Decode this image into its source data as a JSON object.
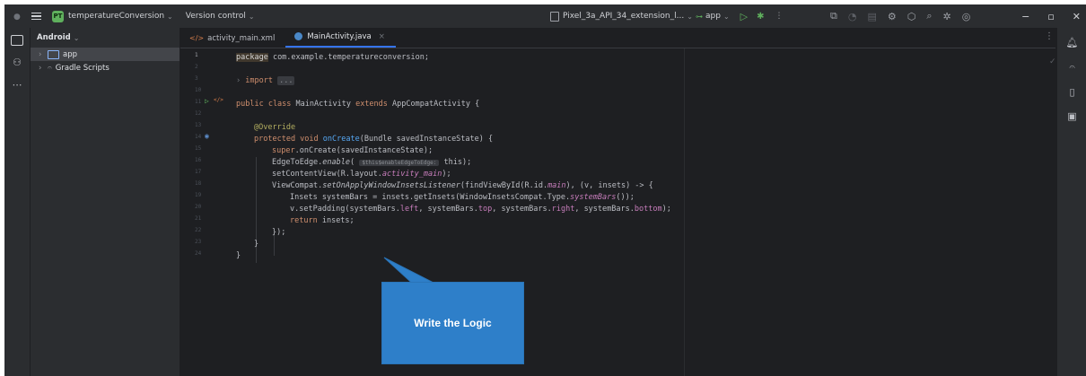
{
  "titlebar": {
    "project_badge": "PT",
    "project_name": "temperatureConversion",
    "version_control": "Version control",
    "device": "Pixel_3a_API_34_extension_l...",
    "app_config": "app"
  },
  "project_panel": {
    "view_mode": "Android",
    "tree": [
      {
        "label": "app",
        "selected": true
      },
      {
        "label": "Gradle Scripts",
        "selected": false
      }
    ]
  },
  "tabs": [
    {
      "label": "activity_main.xml",
      "active": false
    },
    {
      "label": "MainActivity.java",
      "active": true
    }
  ],
  "code": {
    "line_numbers": [
      "1",
      "2",
      "3",
      "10",
      "11",
      "12",
      "13",
      "14",
      "15",
      "16",
      "17",
      "18",
      "19",
      "20",
      "21",
      "22",
      "23",
      "24"
    ],
    "l1_kw": "package",
    "l1_rest": " com.example.temperatureconversion;",
    "l3_kw": "import",
    "l3_fold": "...",
    "l11_kw": "public class",
    "l11_name": " MainActivity ",
    "l11_kw2": "extends",
    "l11_rest": " AppCompatActivity {",
    "l13_ann": "@Override",
    "l14_kw": "protected void",
    "l14_fn": " onCreate",
    "l14_rest": "(Bundle savedInstanceState) {",
    "l15_kw": "super",
    "l15_rest": ".onCreate(savedInstanceState);",
    "l16_a": "EdgeToEdge.",
    "l16_it": "enable",
    "l16_b": "( ",
    "l16_hint": "$this$enableEdgeToEdge:",
    "l16_c": " this);",
    "l17_a": "setContentView(R.layout.",
    "l17_fld": "activity_main",
    "l17_b": ");",
    "l18_a": "ViewCompat.",
    "l18_it": "setOnApplyWindowInsetsListener",
    "l18_b": "(findViewById(R.id.",
    "l18_fld": "main",
    "l18_c": "), (v, insets) -> {",
    "l19_a": "Insets systemBars = insets.getInsets(WindowInsetsCompat.Type.",
    "l19_it": "systemBars",
    "l19_b": "());",
    "l20_a": "v.setPadding(systemBars.",
    "l20_f1": "left",
    "l20_b": ", systemBars.",
    "l20_f2": "top",
    "l20_c": ", systemBars.",
    "l20_f3": "right",
    "l20_d": ", systemBars.",
    "l20_f4": "bottom",
    "l20_e": ");",
    "l21_kw": "return",
    "l21_rest": " insets;",
    "l22": "});",
    "l23": "}",
    "l24": "}"
  },
  "callout": {
    "text": "Write the Logic",
    "color": "#2e7fc9"
  }
}
